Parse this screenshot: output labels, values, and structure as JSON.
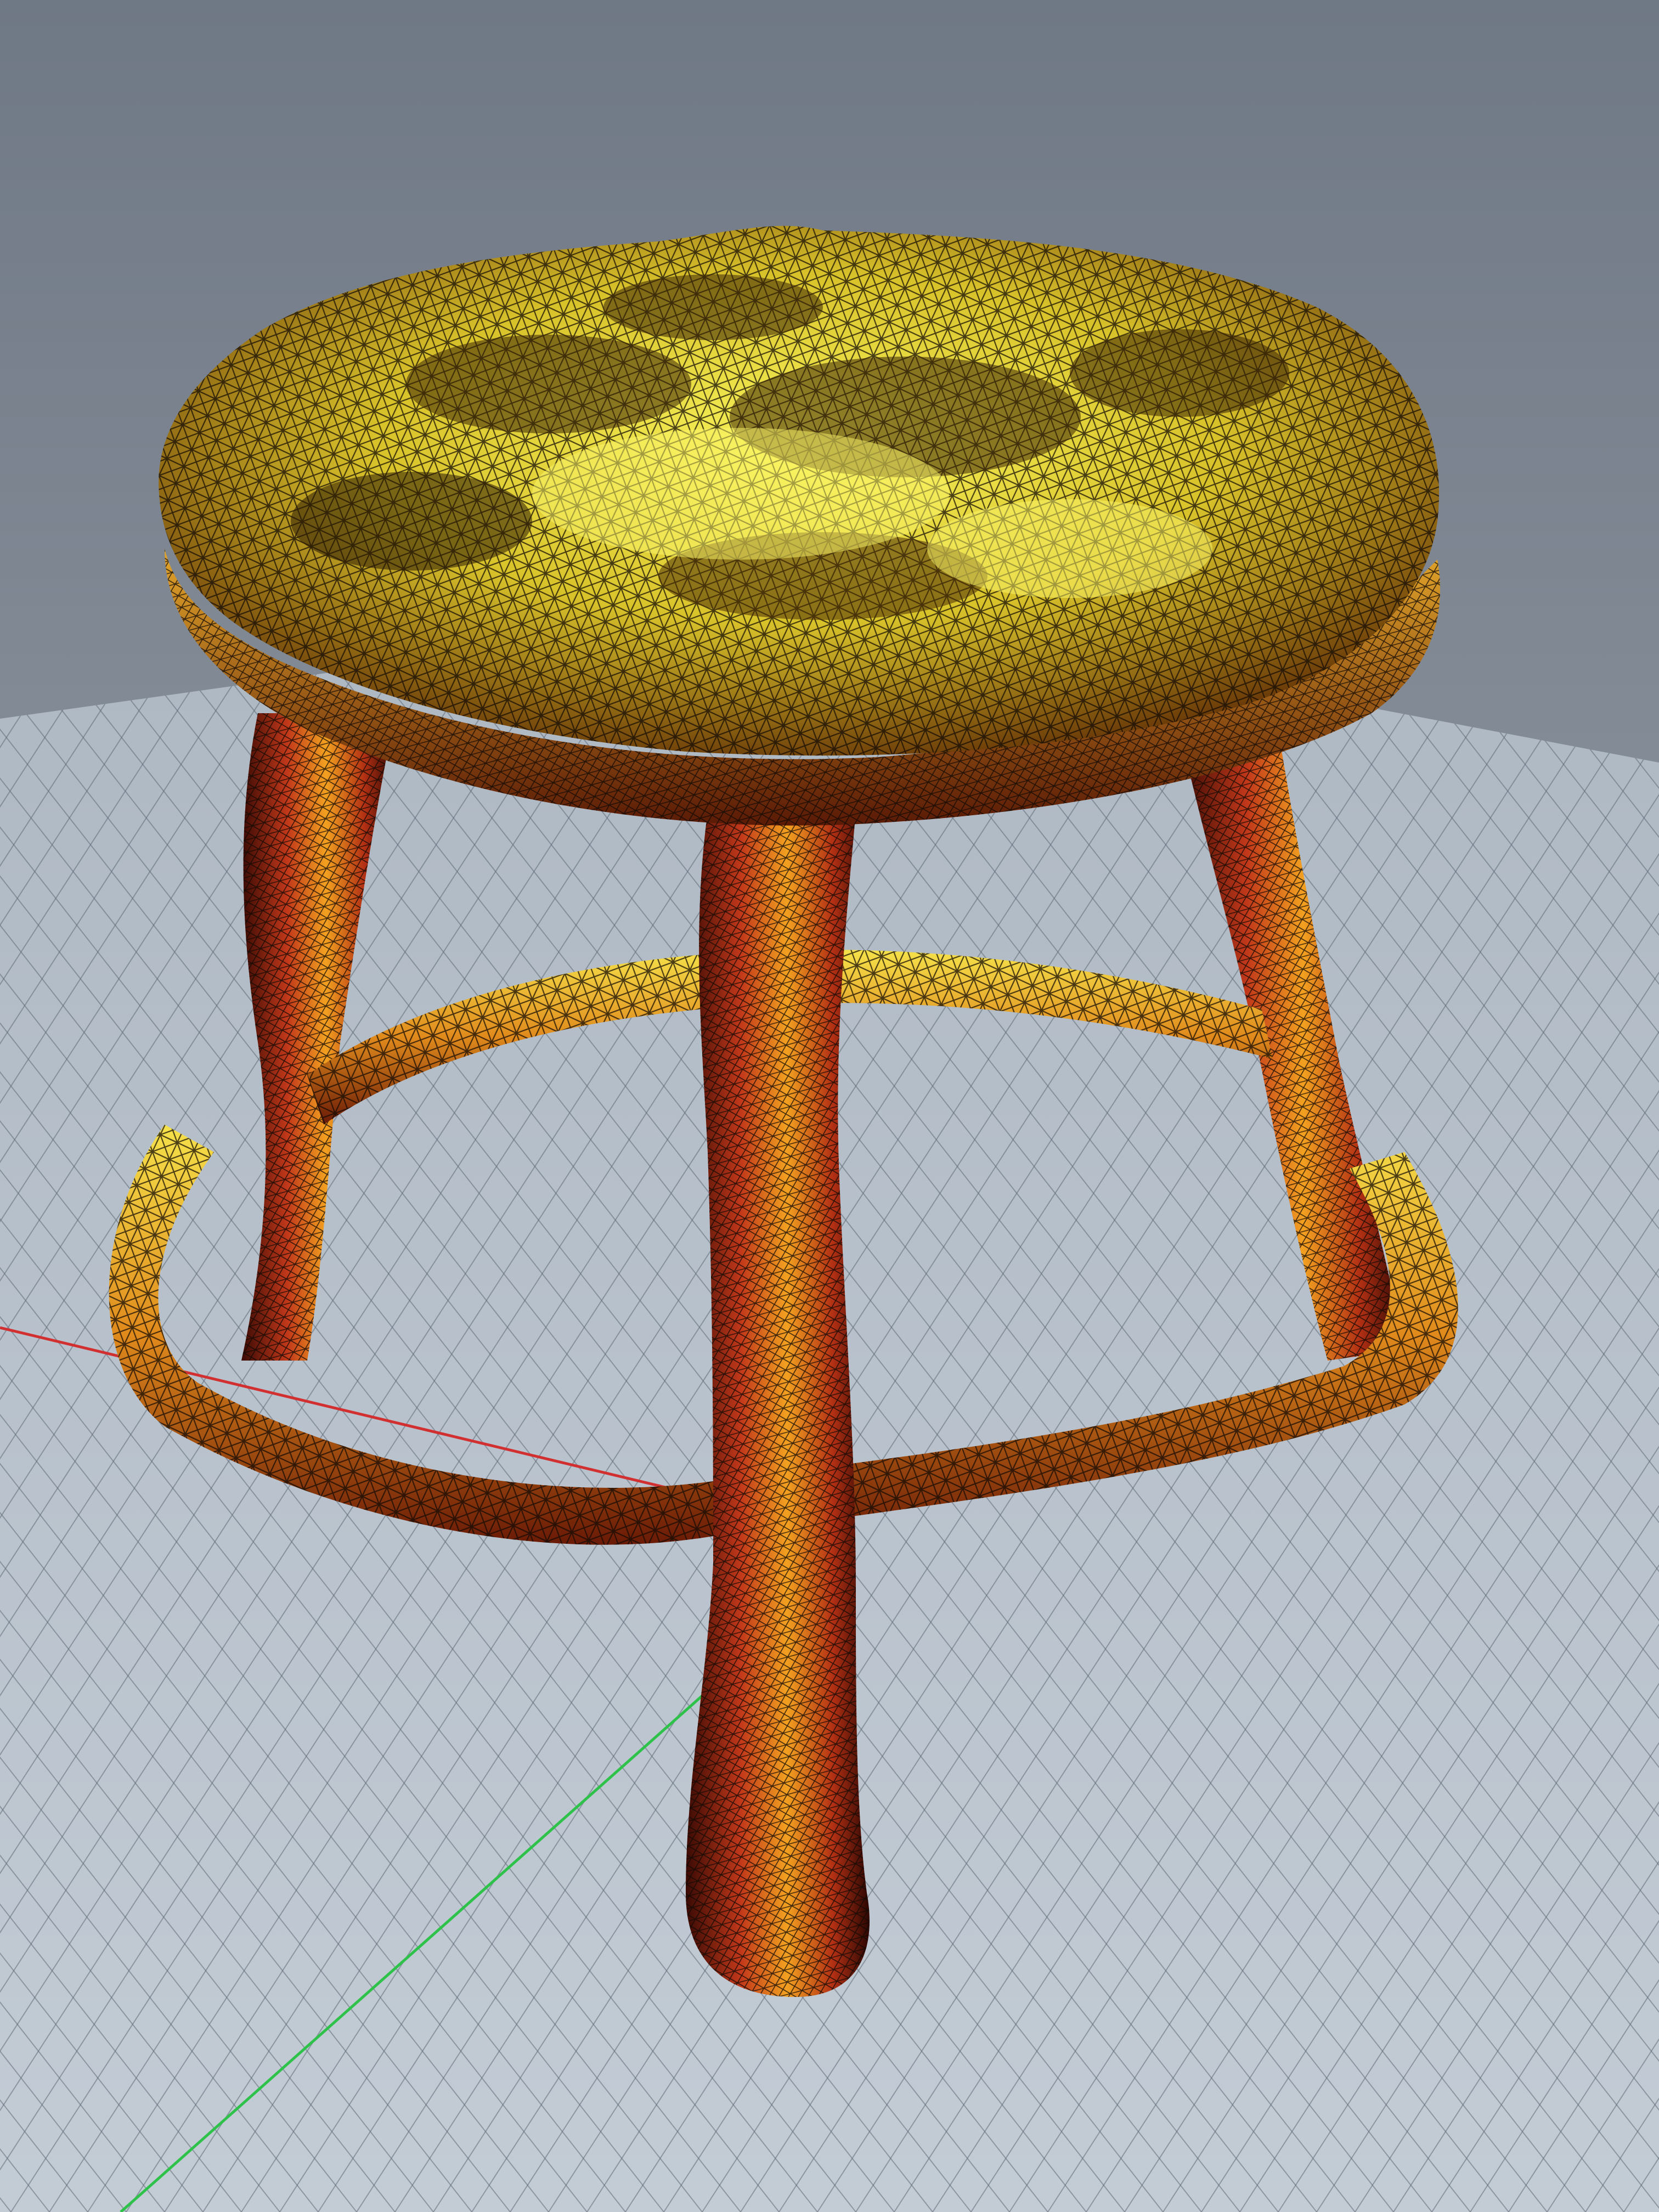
{
  "viewport": {
    "subject": "stool-mesh",
    "render_mode": "wireframe-shaded",
    "colors": {
      "background_top": "#6f7885",
      "background_bottom": "#a4abb3",
      "floor": "#b8c2cc",
      "grid_line": "#5f6b78",
      "axis_x": "#d23030",
      "axis_y": "#2fc24a",
      "mesh_highlight": "#f6f04a",
      "mesh_mid": "#e79a1e",
      "mesh_shadow": "#5a1408",
      "wire": "#120a04"
    }
  }
}
